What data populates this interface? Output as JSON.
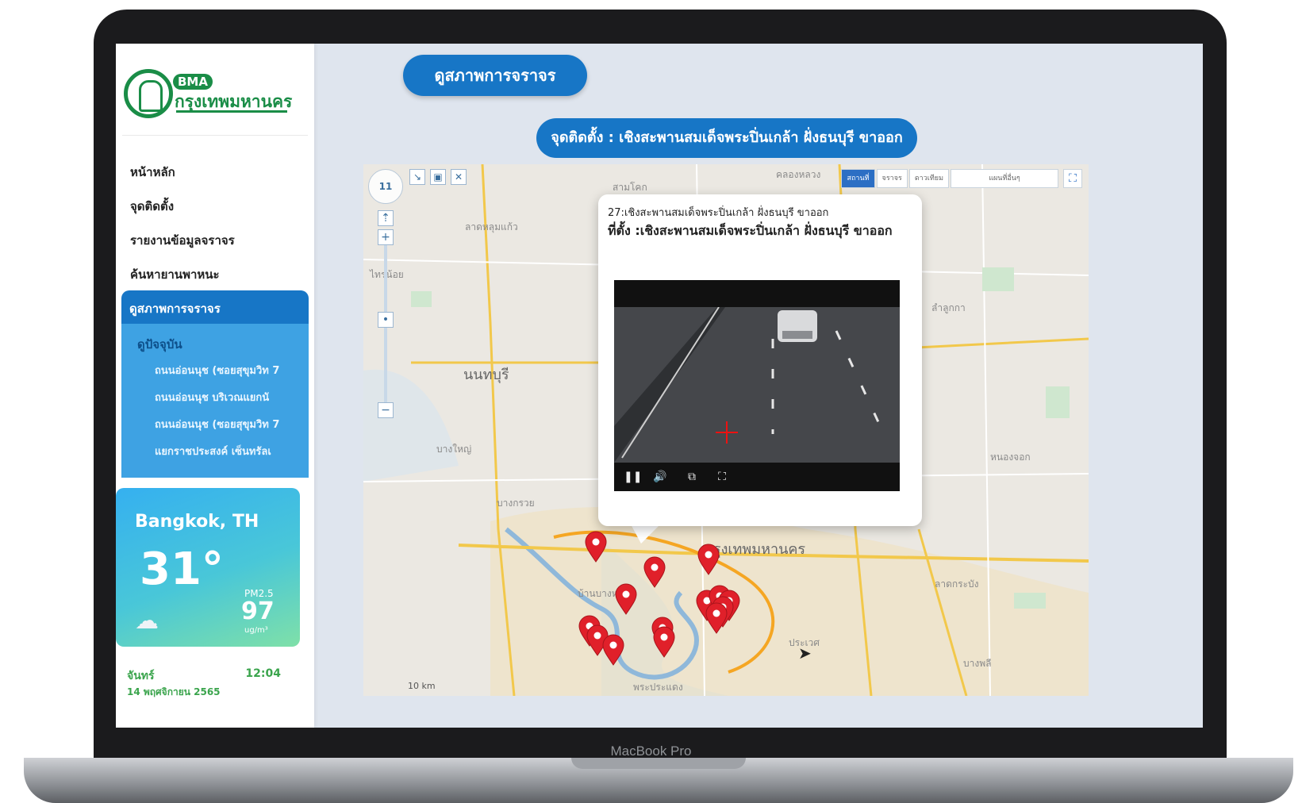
{
  "device": {
    "label": "MacBook Pro"
  },
  "sidebar": {
    "logo": {
      "badge": "BMA",
      "name": "กรุงเทพมหานคร"
    },
    "nav": [
      {
        "label": "หน้าหลัก"
      },
      {
        "label": "จุดติดตั้ง"
      },
      {
        "label": "รายงานข้อมูลจราจร"
      },
      {
        "label": "ค้นหายานพาหนะ"
      }
    ],
    "active": {
      "label": "ดูสภาพการจราจร"
    },
    "sub": {
      "head": "ดูปัจจุบัน",
      "items": [
        {
          "label": "ถนนอ่อนนุช (ซอยสุขุมวิท 7"
        },
        {
          "label": "ถนนอ่อนนุช บริเวณแยกนั"
        },
        {
          "label": "ถนนอ่อนนุช (ซอยสุขุมวิท 7"
        },
        {
          "label": "แยกราชประสงค์ เซ็นทรัลเ"
        }
      ]
    }
  },
  "weather": {
    "city": "Bangkok, TH",
    "temperature": "31°",
    "condition_icon": "cloud-icon",
    "pm_label": "PM2.5",
    "pm_value": "97",
    "pm_unit": "ug/m³"
  },
  "day": {
    "name": "จันทร์",
    "time": "12:04",
    "date": "14 พฤศจิกายน 2565"
  },
  "main": {
    "title": "ดูสภาพการจราจร",
    "location_banner": "จุดติดตั้ง : เชิงสะพานสมเด็จพระปิ่นเกล้า ฝั่งธนบุรี ขาออก"
  },
  "map": {
    "zoom_level": "11",
    "layers": [
      "สถานที่",
      "จราจร",
      "ดาวเทียม"
    ],
    "active_layer": "สถานที่",
    "layer_select": "แผนที่อื่นๆ",
    "scale": "10 km",
    "labels": [
      {
        "text": "นนทบุรี",
        "big": true
      },
      {
        "text": "บางใหญ่",
        "big": false
      },
      {
        "text": "บางกรวย",
        "big": false
      },
      {
        "text": "กรุงเทพมหานคร",
        "big": true
      },
      {
        "text": "ไทรน้อย",
        "big": false
      },
      {
        "text": "ลาดหลุมแก้ว",
        "big": false
      },
      {
        "text": "คลองหลวง",
        "big": false
      },
      {
        "text": "สามโคก",
        "big": false
      },
      {
        "text": "ลำลูกกา",
        "big": false
      },
      {
        "text": "หนองจอก",
        "big": false
      },
      {
        "text": "ประเวศ",
        "big": false
      },
      {
        "text": "พระประแดง",
        "big": false
      },
      {
        "text": "บ้านบางหว้า",
        "big": false
      },
      {
        "text": "ลาดกระบัง",
        "big": false
      },
      {
        "text": "บางพลี",
        "big": false
      }
    ],
    "popup": {
      "header": "27:เชิงสะพานสมเด็จพระปิ่นเกล้า ฝั่งธนบุรี ขาออก",
      "location": "ที่ตั้ง :เชิงสะพานสมเด็จพระปิ่นเกล้า ฝั่งธนบุรี ขาออก"
    },
    "camera_pins": 14
  },
  "colors": {
    "brand_green": "#1a8d47",
    "primary_blue": "#1776c6",
    "pin_red": "#e0202a"
  }
}
